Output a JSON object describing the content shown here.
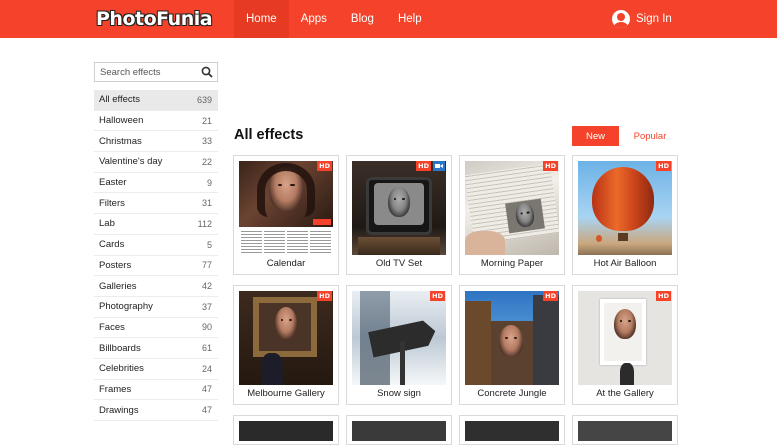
{
  "header": {
    "logo": "PhotoFunia",
    "nav": [
      "Home",
      "Apps",
      "Blog",
      "Help"
    ],
    "signin": "Sign In"
  },
  "search": {
    "placeholder": "Search effects",
    "icon": "search-icon"
  },
  "categories": [
    {
      "label": "All effects",
      "count": "639"
    },
    {
      "label": "Halloween",
      "count": "21"
    },
    {
      "label": "Christmas",
      "count": "33"
    },
    {
      "label": "Valentine's day",
      "count": "22"
    },
    {
      "label": "Easter",
      "count": "9"
    },
    {
      "label": "Filters",
      "count": "31"
    },
    {
      "label": "Lab",
      "count": "112"
    },
    {
      "label": "Cards",
      "count": "5"
    },
    {
      "label": "Posters",
      "count": "77"
    },
    {
      "label": "Galleries",
      "count": "42"
    },
    {
      "label": "Photography",
      "count": "37"
    },
    {
      "label": "Faces",
      "count": "90"
    },
    {
      "label": "Billboards",
      "count": "61"
    },
    {
      "label": "Celebrities",
      "count": "24"
    },
    {
      "label": "Frames",
      "count": "47"
    },
    {
      "label": "Drawings",
      "count": "47"
    }
  ],
  "main": {
    "title": "All effects",
    "sort_new": "New",
    "sort_popular": "Popular",
    "hd_badge": "HD"
  },
  "effects": [
    {
      "label": "Calendar"
    },
    {
      "label": "Old TV Set"
    },
    {
      "label": "Morning Paper"
    },
    {
      "label": "Hot Air Balloon"
    },
    {
      "label": "Melbourne Gallery"
    },
    {
      "label": "Snow sign"
    },
    {
      "label": "Concrete Jungle"
    },
    {
      "label": "At the Gallery"
    }
  ],
  "colors": {
    "brand": "#f4432a",
    "video_badge": "#2a74c9"
  }
}
